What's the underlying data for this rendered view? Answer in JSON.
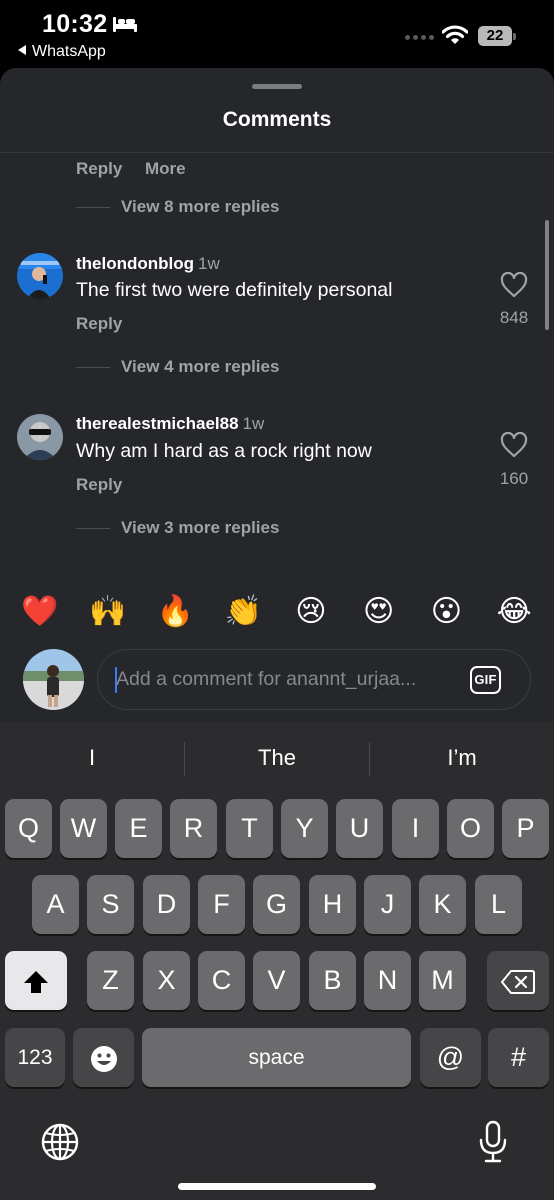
{
  "status_bar": {
    "time": "10:32",
    "back_app": "WhatsApp",
    "battery": "22",
    "icons": [
      "bed-icon",
      "wifi-icon",
      "battery-icon"
    ]
  },
  "sheet": {
    "title": "Comments",
    "prev_actions": {
      "reply": "Reply",
      "more": "More"
    },
    "prev_view_more": "View 8 more replies"
  },
  "comments": [
    {
      "username": "thelondonblog",
      "ago": "1w",
      "text": "The first two were definitely personal",
      "reply": "Reply",
      "likes": "848",
      "view_more": "View 4 more replies"
    },
    {
      "username": "therealestmichael88",
      "ago": "1w",
      "text": "Why am I hard as a rock right now",
      "reply": "Reply",
      "likes": "160",
      "view_more": "View 3 more replies"
    }
  ],
  "emoji_bar": [
    "❤️",
    "🙌",
    "🔥",
    "👏",
    "😢",
    "😍",
    "😮",
    "😂"
  ],
  "composer": {
    "placeholder": "Add a comment for anannt_urjaa...",
    "gif_label": "GIF"
  },
  "keyboard": {
    "suggestions": [
      "I",
      "The",
      "I’m"
    ],
    "row1": [
      "Q",
      "W",
      "E",
      "R",
      "T",
      "Y",
      "U",
      "I",
      "O",
      "P"
    ],
    "row2": [
      "A",
      "S",
      "D",
      "F",
      "G",
      "H",
      "J",
      "K",
      "L"
    ],
    "row3": [
      "Z",
      "X",
      "C",
      "V",
      "B",
      "N",
      "M"
    ],
    "numbers_label": "123",
    "space_label": "space",
    "at_label": "@",
    "hash_label": "#"
  }
}
